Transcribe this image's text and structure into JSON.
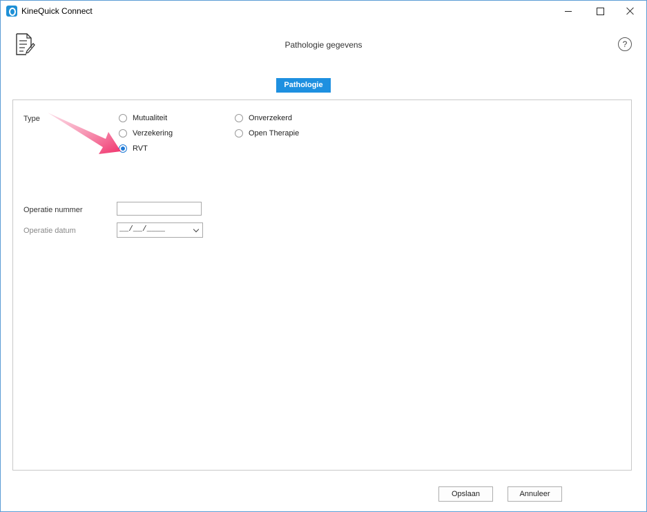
{
  "window": {
    "title": "KineQuick Connect"
  },
  "header": {
    "page_title": "Pathologie gegevens",
    "help_label": "?"
  },
  "tabs": [
    {
      "label": "Pathologie",
      "active": true
    }
  ],
  "form": {
    "type_label": "Type",
    "type_options": [
      {
        "label": "Mutualiteit",
        "checked": false
      },
      {
        "label": "Onverzekerd",
        "checked": false
      },
      {
        "label": "Verzekering",
        "checked": false
      },
      {
        "label": "Open Therapie",
        "checked": false
      },
      {
        "label": "RVT",
        "checked": true
      }
    ],
    "operatie_nummer_label": "Operatie nummer",
    "operatie_nummer_value": "",
    "operatie_datum_label": "Operatie datum",
    "operatie_datum_value": "__/__/____"
  },
  "footer": {
    "save_label": "Opslaan",
    "cancel_label": "Annuleer"
  },
  "colors": {
    "accent": "#1e90e0",
    "annotation_arrow": "#f0306a"
  }
}
